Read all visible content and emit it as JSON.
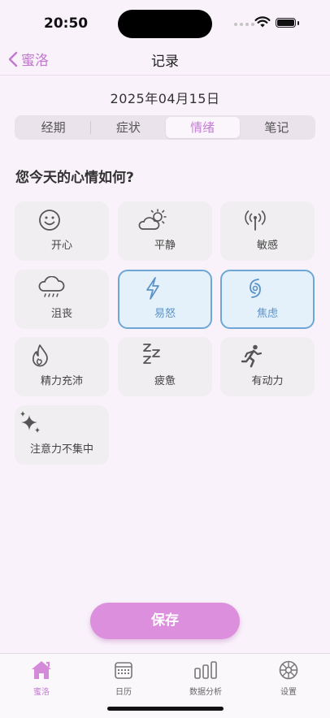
{
  "status_bar": {
    "time": "20:50"
  },
  "nav": {
    "back_label": "蜜洛",
    "title": "记录"
  },
  "date": "2025年04月15日",
  "segments": [
    "经期",
    "症状",
    "情绪",
    "笔记"
  ],
  "selected_segment": "情绪",
  "question": "您今天的心情如何?",
  "moods": [
    {
      "label": "开心",
      "icon": "smiley-icon",
      "selected": false
    },
    {
      "label": "平静",
      "icon": "partly-cloudy-icon",
      "selected": false
    },
    {
      "label": "敏感",
      "icon": "antenna-icon",
      "selected": false
    },
    {
      "label": "沮丧",
      "icon": "rain-cloud-icon",
      "selected": false
    },
    {
      "label": "易怒",
      "icon": "lightning-icon",
      "selected": true
    },
    {
      "label": "焦虑",
      "icon": "hurricane-icon",
      "selected": true
    },
    {
      "label": "精力充沛",
      "icon": "flame-icon",
      "selected": false
    },
    {
      "label": "疲惫",
      "icon": "sleep-zzz-icon",
      "selected": false
    },
    {
      "label": "有动力",
      "icon": "running-figure-icon",
      "selected": false
    },
    {
      "label": "注意力不集中",
      "icon": "sparkles-icon",
      "selected": false
    }
  ],
  "save_label": "保存",
  "tabs": [
    {
      "label": "蜜洛",
      "icon": "home-icon",
      "active": true
    },
    {
      "label": "日历",
      "icon": "calendar-icon",
      "active": false
    },
    {
      "label": "数据分析",
      "icon": "bar-chart-icon",
      "active": false
    },
    {
      "label": "设置",
      "icon": "gear-icon",
      "active": false
    }
  ],
  "colors": {
    "accent": "#c77fd6",
    "selected_border": "#6ea7d5",
    "selected_fill": "#e4f1fb",
    "save_button": "#dc8fdc"
  }
}
